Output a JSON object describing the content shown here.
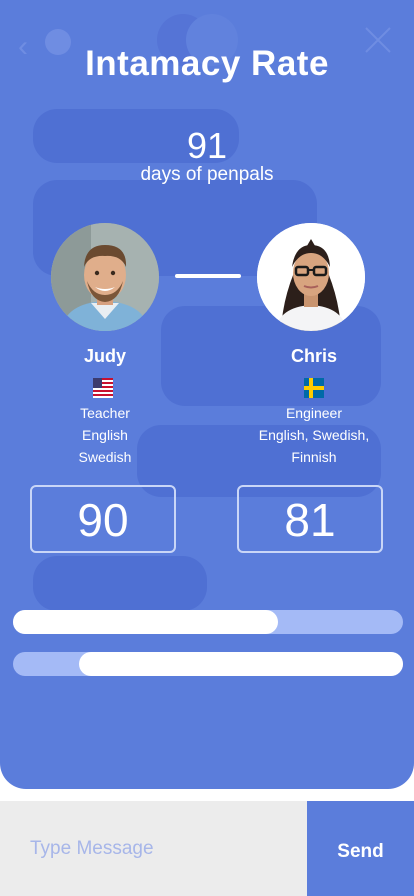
{
  "header": {
    "title": "Intamacy Rate"
  },
  "stats": {
    "days_value": "91",
    "days_label": "days of penpals"
  },
  "users": [
    {
      "name": "Judy",
      "flag": "us-flag-icon",
      "profession": "Teacher",
      "languages": [
        "English",
        "Swedish"
      ],
      "score": "90",
      "bar_fraction": 0.68
    },
    {
      "name": "Chris",
      "flag": "sweden-flag-icon",
      "profession": "Engineer",
      "languages": [
        "English, Swedish,",
        "Finnish"
      ],
      "score": "81",
      "bar_fraction": 0.83
    }
  ],
  "composer": {
    "placeholder": "Type Message",
    "send_label": "Send"
  },
  "colors": {
    "accent": "#5b7ddb",
    "bar_track": "#a4baf6",
    "bubble": "#4f70d3",
    "composer_bg": "#ececec"
  }
}
